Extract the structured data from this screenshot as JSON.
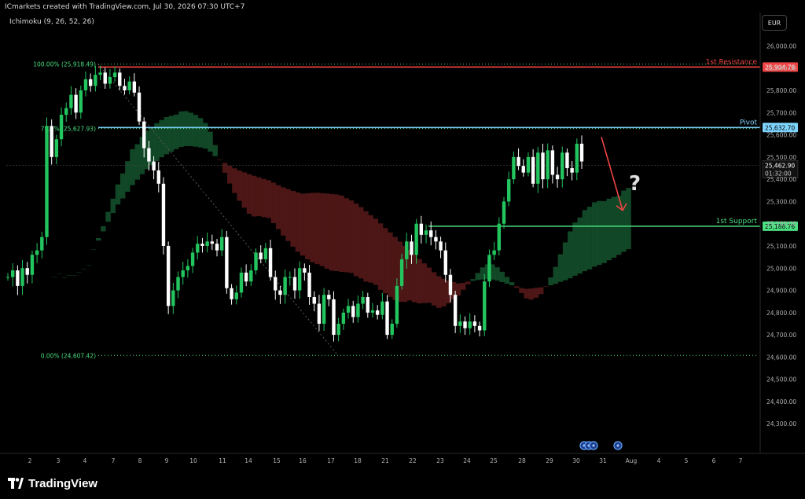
{
  "header": {
    "attribution": "ICmarkets created with TradingView.com, Jul 30, 2026 07:30 UTC+7",
    "indicator": "Ichimoku (9, 26, 52, 26)",
    "currency_button": "EUR"
  },
  "annotation": {
    "question_mark": "?"
  },
  "brand": {
    "name": "TradingView"
  },
  "colors": {
    "background": "#000000",
    "up_candle": "#22c55e",
    "down_candle": "#ffffff",
    "resistance": "#ef4444",
    "pivot": "#7dd3fc",
    "support": "#4ade80",
    "arrow": "#ef4444",
    "cloud_bull": "#14532d",
    "cloud_bear": "#5b1a1a",
    "fib": "#4ade80"
  },
  "chart_data": {
    "type": "candlestick",
    "ylim": [
      24170,
      26150
    ],
    "y_ticks": [
      "26,000.00",
      "25,900.00",
      "25,800.00",
      "25,700.00",
      "25,600.00",
      "25,500.00",
      "25,400.00",
      "25,300.00",
      "25,200.00",
      "25,100.00",
      "25,000.00",
      "24,900.00",
      "24,800.00",
      "24,700.00",
      "24,600.00",
      "24,500.00",
      "24,400.00",
      "24,300.00"
    ],
    "y_tick_values": [
      26000,
      25900,
      25800,
      25700,
      25600,
      25500,
      25400,
      25300,
      25200,
      25100,
      25000,
      24900,
      24800,
      24700,
      24600,
      24500,
      24400,
      24300
    ],
    "x_ticks": [
      "2",
      "3",
      "4",
      "7",
      "8",
      "9",
      "10",
      "11",
      "14",
      "15",
      "16",
      "17",
      "18",
      "21",
      "22",
      "23",
      "24",
      "25",
      "28",
      "29",
      "30",
      "31",
      "Aug",
      "4",
      "5",
      "6",
      "7"
    ],
    "levels": [
      {
        "name": "1st Resistance",
        "label": "1st Resistance",
        "value": 25904.78,
        "price_label": "25,904.78",
        "color": "#ef4444"
      },
      {
        "name": "Pivot",
        "label": "Pivot",
        "value": 25632.7,
        "price_label": "25,632.70",
        "color": "#7dd3fc"
      },
      {
        "name": "1st Support",
        "label": "1st Support",
        "value": 25188.76,
        "price_label": "25,188.76",
        "color": "#4ade80"
      }
    ],
    "fib": [
      {
        "label": "100.00% (25,918.49)",
        "value": 25918.49
      },
      {
        "label": "78.6% (25,627.93)",
        "value": 25627.93
      },
      {
        "label": "0.00% (24,607.42)",
        "value": 24607.42
      }
    ],
    "last_price": {
      "label": "25,462.90",
      "countdown": "01:32:00",
      "value": 25462.9
    },
    "open": 24960,
    "closes": [
      24960,
      24990,
      24920,
      25000,
      24970,
      25060,
      25080,
      25140,
      25640,
      25500,
      25580,
      25690,
      25720,
      25780,
      25700,
      25800,
      25850,
      25820,
      25870,
      25880,
      25830,
      25860,
      25880,
      25820,
      25800,
      25840,
      25790,
      25660,
      25540,
      25480,
      25440,
      25380,
      25100,
      24830,
      24900,
      24960,
      24990,
      25010,
      25070,
      25110,
      25100,
      25120,
      25110,
      25080,
      25140,
      24910,
      24860,
      24890,
      24980,
      24940,
      24990,
      25070,
      25040,
      25090,
      24960,
      24900,
      24880,
      24960,
      24960,
      24900,
      25000,
      24980,
      24870,
      24840,
      24750,
      24880,
      24860,
      24700,
      24750,
      24800,
      24830,
      24780,
      24840,
      24870,
      24800,
      24810,
      24790,
      24850,
      24700,
      24750,
      24920,
      25040,
      25120,
      25060,
      25200,
      25150,
      25170,
      25140,
      25120,
      25080,
      24970,
      24880,
      24740,
      24760,
      24730,
      24760,
      24740,
      24720,
      24940,
      25060,
      25080,
      25200,
      25300,
      25400,
      25500,
      25460,
      25430,
      25500,
      25380,
      25520,
      25400,
      25530,
      25420,
      25400,
      25520,
      25450,
      25430,
      25560,
      25480
    ],
    "arrow": {
      "from_value": 25590,
      "to_value": 25260
    }
  }
}
